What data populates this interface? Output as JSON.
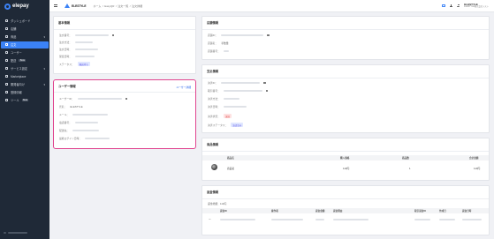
{
  "app": {
    "logo_text": "elepay"
  },
  "sidebar": {
    "items": [
      {
        "label": "ダッシュボード",
        "icon": "dashboard-icon",
        "active": false
      },
      {
        "label": "店舗",
        "icon": "store-icon",
        "active": false
      },
      {
        "label": "商品",
        "icon": "product-icon",
        "active": false,
        "caret": "▾"
      },
      {
        "label": "注文",
        "icon": "order-icon",
        "active": true
      },
      {
        "label": "ユーザー",
        "icon": "user-icon",
        "active": false
      },
      {
        "label": "配送",
        "icon": "delivery-icon",
        "active": false,
        "badge": "Beta"
      },
      {
        "label": "サービス設定",
        "icon": "settings-icon",
        "active": false,
        "caret": "▾"
      },
      {
        "label": "Marketplace",
        "icon": "marketplace-icon",
        "active": false
      },
      {
        "label": "開発者向け",
        "icon": "developer-icon",
        "active": false,
        "caret": "▾"
      },
      {
        "label": "登録情報",
        "icon": "info-icon",
        "active": false
      },
      {
        "label": "ツール",
        "icon": "tools-icon",
        "active": false,
        "badge": "Beta"
      }
    ]
  },
  "topbar": {
    "brand": "ELESTYLE",
    "breadcrumbs": [
      "ホーム",
      "/",
      "EasyQR",
      "/",
      "注文一覧",
      "/",
      "注文詳細"
    ],
    "user_name": "ELESTYLE",
    "user_sub": "ELESTYLE株式会社テスト"
  },
  "basic_info": {
    "title": "基本情報",
    "labels": [
      "注文番号：",
      "注文方法：",
      "注文日時：",
      "受渡日時：",
      "ステータス："
    ],
    "status": "配送待ち"
  },
  "store_info": {
    "title": "店舗情報",
    "labels": [
      "店舗ID：",
      "店舗名：",
      "店舗番号："
    ],
    "store_name_value": "手数量"
  },
  "payment_info": {
    "title": "支払情報",
    "labels": [
      "決済ID：",
      "取引番号：",
      "決済方法：",
      "決済日時：",
      "決済状況：",
      "決済ステータス："
    ],
    "status_value": "決済",
    "payment_status": "決済済み"
  },
  "user_info": {
    "title": "ユーザー情報",
    "edit_label": "ユーザー詳細",
    "labels": [
      "ユーザーID：",
      "氏名：",
      "メール：",
      "電話番号：",
      "配送先：",
      "最終ログイン日時："
    ],
    "name_value": "ELESTYLE"
  },
  "product_info": {
    "title": "商品情報",
    "columns": [
      "商品名",
      "購入価格",
      "商品数",
      "合計金額"
    ],
    "rows": [
      {
        "name": "商品名",
        "price": "110円",
        "qty": "1",
        "total": "110円"
      }
    ]
  },
  "refund_info": {
    "title": "返金情報",
    "summary": "返金総額：110円",
    "columns": [
      "返金ID",
      "操作者",
      "返金金額",
      "返金理由",
      "取引返金ID",
      "作成日",
      "返金日時"
    ],
    "rows": [
      {
        "prefix": "ー"
      }
    ]
  },
  "colors": {
    "sidebar_bg": "#1f2937",
    "accent": "#3b82f6",
    "highlight_frame": "#e0448f"
  }
}
